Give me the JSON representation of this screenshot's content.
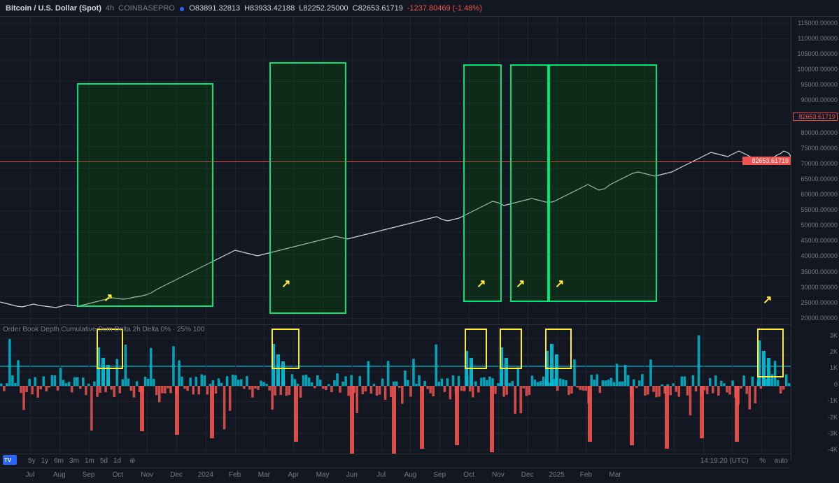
{
  "header": {
    "symbol": "Bitcoin / U.S. Dollar (Spot)",
    "timeframe": "4h",
    "exchange": "COINBASEPRO",
    "open": "83891.32813",
    "high": "83933.42188",
    "low": "82252.25000",
    "close": "82653.61719",
    "change": "-1237.80469",
    "change_pct": "-1.48%",
    "current_price": "82653.61719"
  },
  "price_axis": {
    "labels": [
      "115000.00000",
      "110000.00000",
      "105000.00000",
      "100000.00000",
      "95000.00000",
      "90000.00000",
      "85000.00000",
      "80000.00000",
      "75000.00000",
      "70000.00000",
      "65000.00000",
      "60000.00000",
      "55000.00000",
      "50000.00000",
      "45000.00000",
      "40000.00000",
      "35000.00000",
      "30000.00000",
      "25000.00000",
      "20000.00000"
    ]
  },
  "indicator_axis": {
    "labels": [
      "3K",
      "2K",
      "1K",
      "0",
      "-1K",
      "-2K",
      "-3K",
      "-4K"
    ]
  },
  "time_axis": {
    "labels": [
      "Jul",
      "Aug",
      "Sep",
      "Oct",
      "Nov",
      "Dec",
      "2024",
      "Feb",
      "Mar",
      "Apr",
      "May",
      "Jun",
      "Jul",
      "Aug",
      "Sep",
      "Oct",
      "Nov",
      "Dec",
      "2025",
      "Feb",
      "Mar"
    ]
  },
  "indicator_title": "Order Book Depth Cumulative Sum Delta  2h Delta 0%  ·  25% 100",
  "bottom_toolbar": {
    "timeframes": [
      "5y",
      "1y",
      "6m",
      "3m",
      "1m",
      "5d",
      "1d"
    ],
    "time_utc": "14:19:20 (UTC)",
    "scale_mode": "%",
    "auto": "auto"
  },
  "colors": {
    "background": "#131722",
    "grid": "#1e222d",
    "green_rect": "#00e676",
    "yellow_rect": "#ffeb3b",
    "arrow": "#ffeb3b",
    "price_line": "#ef5350",
    "bar_teal": "#00bcd4",
    "bar_red": "#ef5350",
    "current_price": "82653.61719"
  }
}
